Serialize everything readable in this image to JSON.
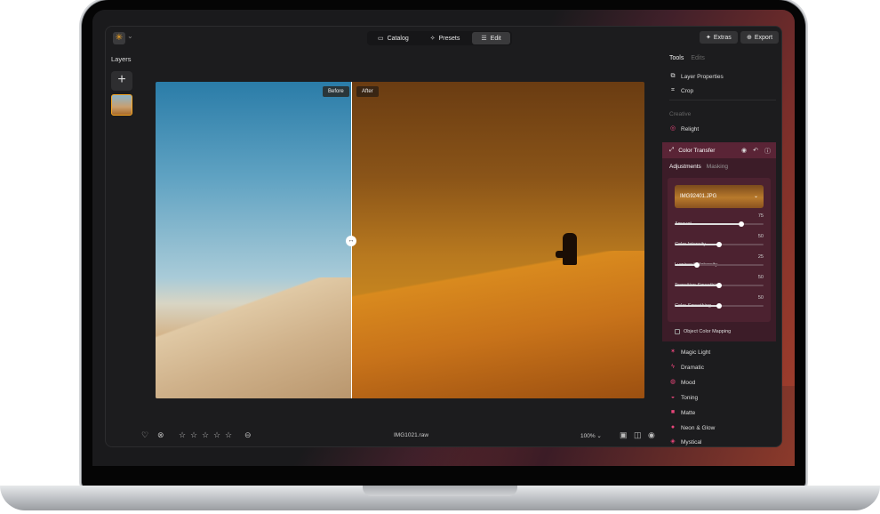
{
  "toolbar": {
    "tabs": [
      {
        "label": "Catalog",
        "icon": "catalog-icon"
      },
      {
        "label": "Presets",
        "icon": "presets-icon"
      },
      {
        "label": "Edit",
        "icon": "edit-icon"
      }
    ],
    "extras_label": "Extras",
    "export_label": "Export"
  },
  "layers": {
    "title": "Layers",
    "add_symbol": "+"
  },
  "canvas": {
    "before_label": "Before",
    "after_label": "After"
  },
  "bottom": {
    "filename": "IMG1021.raw",
    "zoom": "100%",
    "rating_stars": 5
  },
  "panel": {
    "tabs": [
      {
        "label": "Tools"
      },
      {
        "label": "Edits"
      }
    ],
    "top_items": [
      {
        "label": "Layer Properties",
        "icon": "layer-properties-icon"
      },
      {
        "label": "Crop",
        "icon": "crop-icon",
        "badge": "•"
      }
    ],
    "section_creative": "Creative",
    "relight": {
      "label": "Relight",
      "badge": "•"
    },
    "color_transfer": {
      "title": "Color Transfer",
      "tabs": [
        "Adjustments",
        "Masking"
      ],
      "reference_image": "IMG92401.JPG",
      "sliders": [
        {
          "label": "Amount",
          "value": 75
        },
        {
          "label": "Color Intensity",
          "value": 50
        },
        {
          "label": "Luminosity Intensity",
          "value": 25
        },
        {
          "label": "Transition Smoothing",
          "value": 50
        },
        {
          "label": "Color Smoothing",
          "value": 50
        }
      ],
      "object_color_mapping": "Object Color Mapping"
    },
    "creative_items": [
      {
        "label": "Magic Light",
        "icon": "magic-light-icon"
      },
      {
        "label": "Dramatic",
        "icon": "dramatic-icon"
      },
      {
        "label": "Mood",
        "icon": "mood-icon"
      },
      {
        "label": "Toning",
        "icon": "toning-icon"
      },
      {
        "label": "Matte",
        "icon": "matte-icon"
      },
      {
        "label": "Neon & Glow",
        "icon": "neon-glow-icon"
      },
      {
        "label": "Mystical",
        "icon": "mystical-icon"
      }
    ]
  },
  "colors": {
    "accent": "#e8457a",
    "panel_highlight": "#5a2436"
  }
}
